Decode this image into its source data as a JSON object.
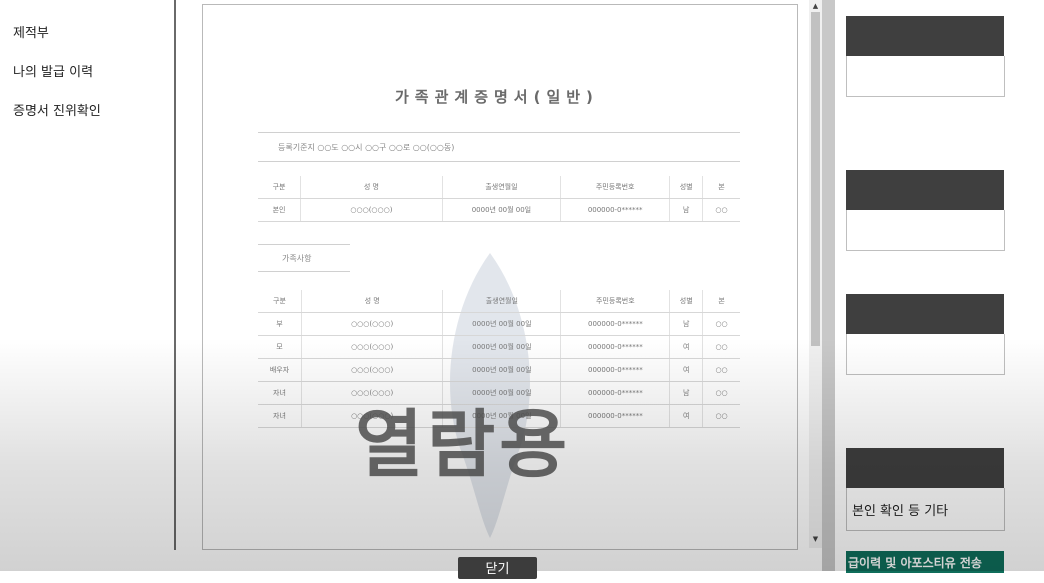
{
  "sidebar": {
    "items": [
      {
        "label": "제적부"
      },
      {
        "label": "나의 발급 이력"
      },
      {
        "label": "증명서 진위확인"
      }
    ]
  },
  "right_panel": {
    "identity_label": "본인 확인 등 기타",
    "green_button_label": "급이력 및 아포스티유 전송"
  },
  "popup": {
    "close_label": "닫기",
    "document": {
      "title": "가족관계증명서(일반)",
      "watermark": "열람용",
      "purpose_line": "등록기준지  ○○도 ○○시 ○○구 ○○로 ○○(○○동)",
      "table1": {
        "headers": [
          "구분",
          "성 명",
          "출생연월일",
          "주민등록번호",
          "성별",
          "본"
        ],
        "rows": [
          [
            "본인",
            "○○○(○○○)",
            "0000년 00월 00일",
            "000000-0******",
            "남",
            "○○"
          ]
        ]
      },
      "section_label": "가족사항",
      "table2": {
        "headers": [
          "구분",
          "성 명",
          "출생연월일",
          "주민등록번호",
          "성별",
          "본"
        ],
        "rows": [
          [
            "부",
            "○○○(○○○)",
            "0000년 00월 00일",
            "000000-0******",
            "남",
            "○○"
          ],
          [
            "모",
            "○○○(○○○)",
            "0000년 00월 00일",
            "000000-0******",
            "여",
            "○○"
          ],
          [
            "배우자",
            "○○○(○○○)",
            "0000년 00월 00일",
            "000000-0******",
            "여",
            "○○"
          ],
          [
            "자녀",
            "○○○(○○○)",
            "0000년 00월 00일",
            "000000-0******",
            "남",
            "○○"
          ],
          [
            "자녀",
            "○○○(○○○)",
            "0000년 00월 00일",
            "000000-0******",
            "여",
            "○○"
          ]
        ]
      }
    }
  }
}
